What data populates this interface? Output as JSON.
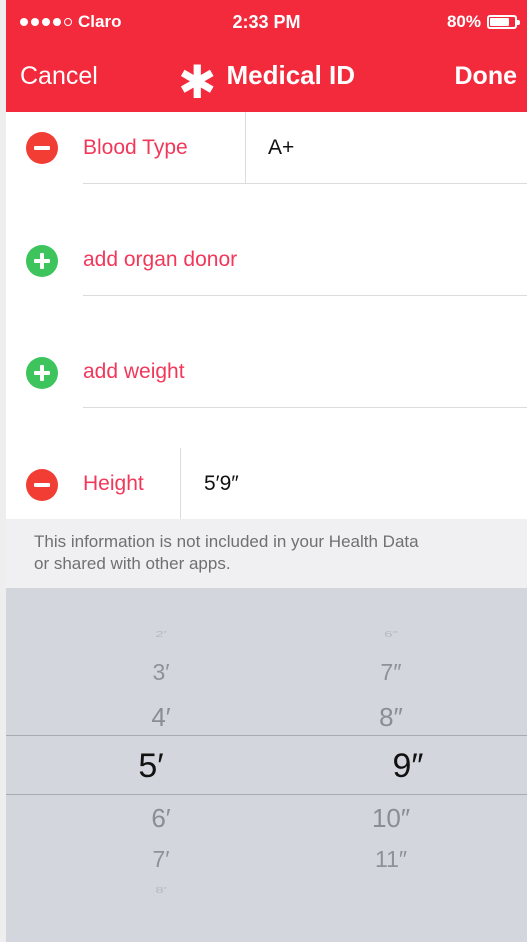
{
  "status_bar": {
    "carrier": "Claro",
    "time": "2:33 PM",
    "battery": "80%",
    "battery_level": 0.8
  },
  "nav": {
    "cancel_label": "Cancel",
    "title": "Medical ID",
    "title_icon": "asterisk-icon",
    "done_label": "Done"
  },
  "rows": {
    "blood_type": {
      "label": "Blood Type",
      "value": "A+",
      "action": "remove"
    },
    "organ_donor": {
      "label": "add organ donor",
      "action": "add"
    },
    "weight": {
      "label": "add weight",
      "action": "add"
    },
    "height": {
      "label": "Height",
      "value": "5′9″",
      "action": "remove"
    }
  },
  "info_text_line1": "This information is not included in your Health Data",
  "info_text_line2": "or shared with other apps.",
  "picker": {
    "feet": {
      "above": [
        "2′",
        "3′",
        "4′"
      ],
      "selected": "5′",
      "below": [
        "6′",
        "7′",
        "8′"
      ]
    },
    "inches": {
      "above": [
        "6″",
        "7″",
        "8″"
      ],
      "selected": "9″",
      "below": [
        "10″",
        "11″"
      ]
    }
  },
  "colors": {
    "brand_red": "#f22a3c",
    "label_red": "#f2385a",
    "remove_red": "#f23d35",
    "add_green": "#3dc45c",
    "picker_bg": "#d3d7dd"
  }
}
